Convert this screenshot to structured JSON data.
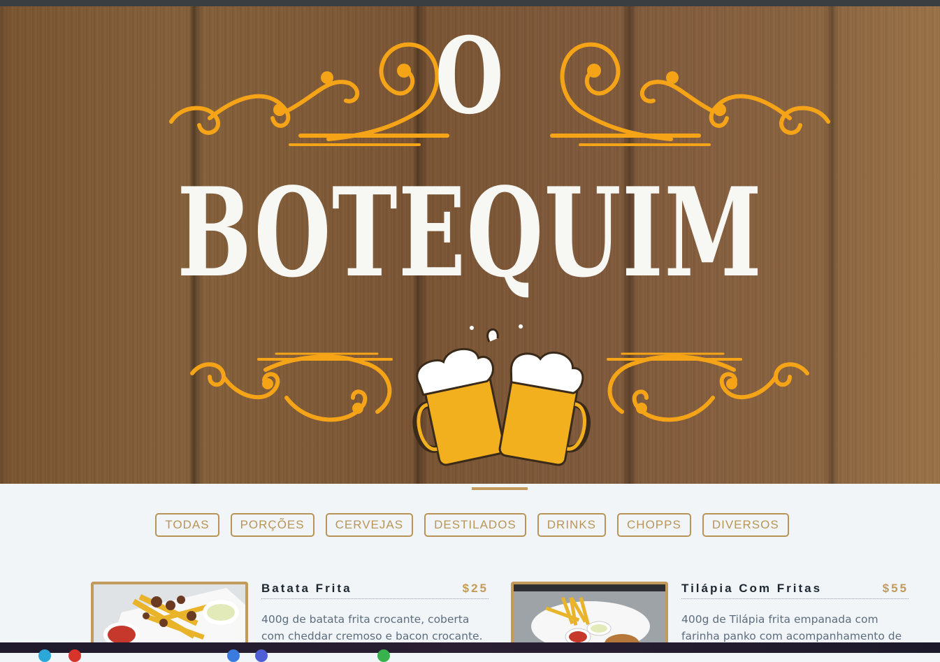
{
  "hero": {
    "logo_top": "O",
    "logo_word": "BOTEQUIM",
    "brand_color": "#f5a418",
    "wood_color": "#7b5430"
  },
  "filters": [
    {
      "label": "TODAS"
    },
    {
      "label": "PORÇÕES"
    },
    {
      "label": "CERVEJAS"
    },
    {
      "label": "DESTILADOS"
    },
    {
      "label": "DRINKS"
    },
    {
      "label": "CHOPPS"
    },
    {
      "label": "DIVERSOS"
    }
  ],
  "items": [
    {
      "name": "Batata Frita",
      "price": "$25",
      "description": "400g de batata frita crocante, coberta com cheddar cremoso e bacon crocante."
    },
    {
      "name": "Tilápia Com Fritas",
      "price": "$55",
      "description": "400g de Tilápia frita empanada com farinha panko com acompanhamento de"
    }
  ],
  "accent_color": "#c29a5b"
}
